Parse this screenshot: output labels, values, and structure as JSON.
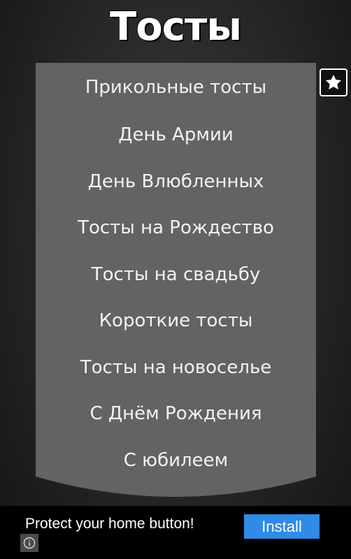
{
  "header": {
    "title": "Тосты"
  },
  "menu": {
    "items": [
      {
        "label": "Прикольные тосты"
      },
      {
        "label": "День Армии"
      },
      {
        "label": "День Влюбленных"
      },
      {
        "label": "Тосты на Рождество"
      },
      {
        "label": "Тосты на свадьбу"
      },
      {
        "label": "Короткие тосты"
      },
      {
        "label": "Тосты на новоселье"
      },
      {
        "label": "С Днём Рождения"
      },
      {
        "label": "С юбилеем"
      }
    ]
  },
  "favorites_button": {
    "icon": "star-icon"
  },
  "ad": {
    "text": "Protect your home button!",
    "install_label": "Install",
    "info_icon": "info-icon",
    "install_color": "#2f8be6"
  }
}
